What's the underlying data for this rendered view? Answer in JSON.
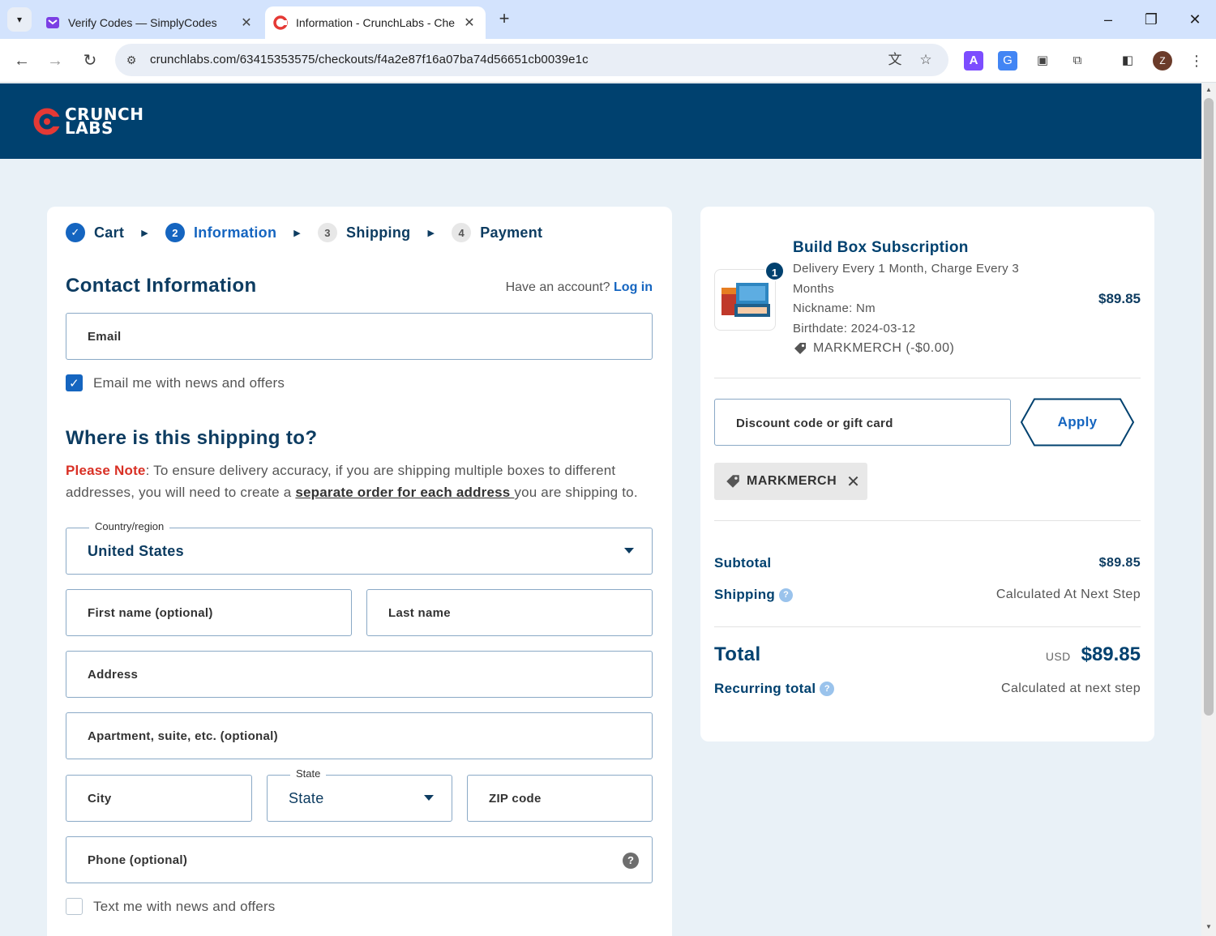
{
  "browser": {
    "tabs": [
      {
        "title": "Verify Codes — SimplyCodes",
        "active": false
      },
      {
        "title": "Information - CrunchLabs - Che",
        "active": true
      }
    ],
    "url": "crunchlabs.com/63415353575/checkouts/f4a2e87f16a07ba74d56651cb0039e1c",
    "profile_initial": "Z",
    "ext_a_label": "A"
  },
  "header": {
    "logo_line1": "CRUNCH",
    "logo_line2": "LABS"
  },
  "steps": [
    {
      "label": "Cart",
      "badge": "✓",
      "state": "done"
    },
    {
      "label": "Information",
      "badge": "2",
      "state": "current"
    },
    {
      "label": "Shipping",
      "badge": "3",
      "state": "todo"
    },
    {
      "label": "Payment",
      "badge": "4",
      "state": "todo"
    }
  ],
  "contact": {
    "title": "Contact Information",
    "account_prompt": "Have an account?",
    "login_label": "Log in",
    "email_placeholder": "Email",
    "news_checkbox_label": "Email me with news and offers",
    "news_checked": true
  },
  "shipping": {
    "title": "Where is this shipping to?",
    "note_prefix": "Please Note",
    "note_text": ": To ensure delivery accuracy, if you are shipping multiple boxes to different addresses, you will need to create a ",
    "note_link": "separate order for each address ",
    "note_suffix": "you are shipping to.",
    "country_label": "Country/region",
    "country_value": "United States",
    "first_name_placeholder": "First name (optional)",
    "last_name_placeholder": "Last name",
    "address_placeholder": "Address",
    "apartment_placeholder": "Apartment, suite, etc. (optional)",
    "city_placeholder": "City",
    "state_label": "State",
    "state_value": "State",
    "zip_placeholder": "ZIP code",
    "phone_placeholder": "Phone (optional)",
    "phone_help": "?",
    "sms_checkbox_label": "Text me with news and offers",
    "sms_checked": false
  },
  "order": {
    "quantity": "1",
    "product_name": "Build Box Subscription",
    "product_lines": [
      "Delivery Every 1 Month, Charge Every 3",
      "Months",
      "Nickname: Nm",
      "Birthdate: 2024-03-12"
    ],
    "product_discount": "MARKMERCH (-$0.00)",
    "product_price": "$89.85",
    "discount_placeholder": "Discount code or gift card",
    "apply_label": "Apply",
    "applied_code": "MARKMERCH",
    "subtotal_label": "Subtotal",
    "subtotal_value": "$89.85",
    "shipping_label": "Shipping",
    "shipping_value": "Calculated At Next Step",
    "total_label": "Total",
    "total_currency": "USD",
    "total_value": "$89.85",
    "recurring_label": "Recurring total",
    "recurring_value": "Calculated at next step"
  },
  "colors": {
    "brand_navy": "#00416f",
    "accent_blue": "#1565c0",
    "warning_red": "#d93025",
    "page_bg": "#e9f1f7"
  }
}
